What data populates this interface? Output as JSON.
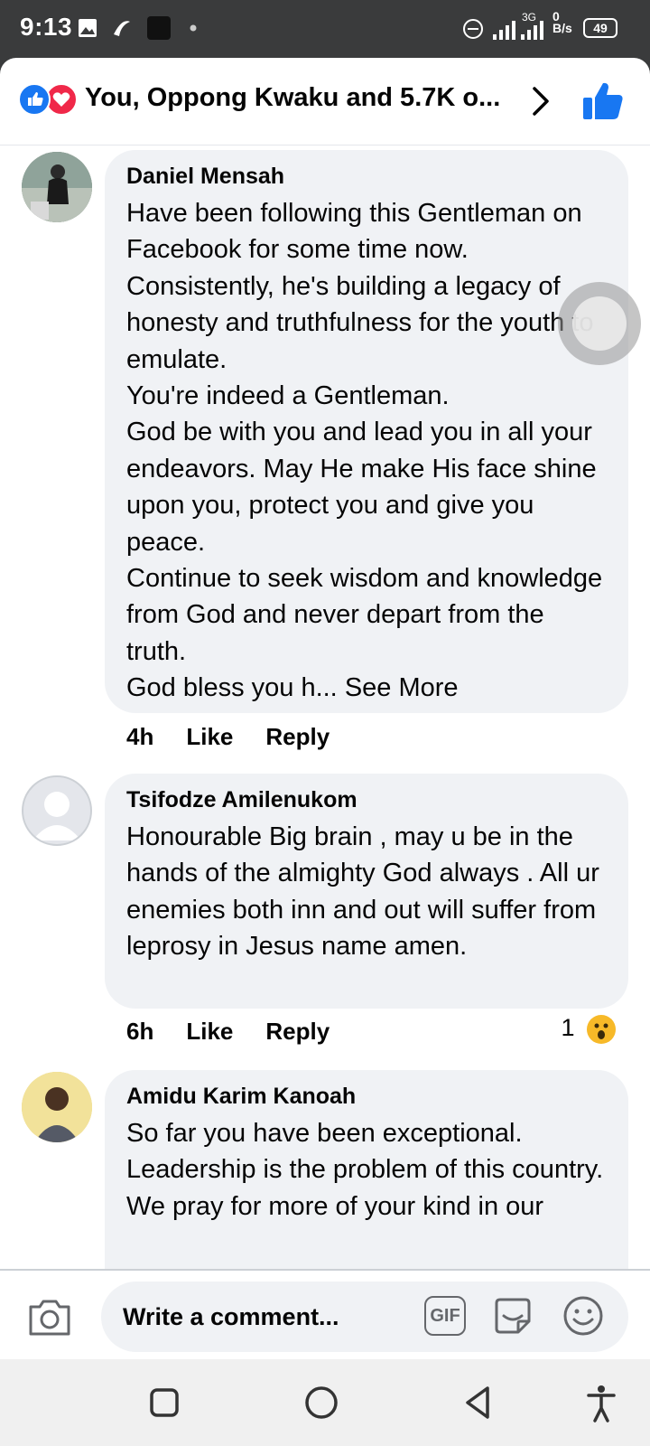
{
  "status": {
    "time": "9:13",
    "signal_label": "3G",
    "speed": "0\nB/s",
    "battery": "49"
  },
  "header": {
    "title": "You, Oppong Kwaku and 5.7K o..."
  },
  "comments": [
    {
      "author": "Daniel Mensah",
      "text": "Have been following this Gentleman on Facebook for some time now.\nConsistently, he's building a legacy of honesty and truthfulness for the youth to emulate.\nYou're indeed a Gentleman.\nGod be with you and lead you in all your endeavors. May He make His face shine upon you, protect you and give you peace.\nContinue to seek wisdom and knowledge from God and never depart from the truth.\nGod bless you h... ",
      "see_more": "See More",
      "time": "4h",
      "like": "Like",
      "reply": "Reply"
    },
    {
      "author": "Tsifodze Amilenukom",
      "text": " Honourable Big brain , may  u be in the hands of the almighty God always . All ur enemies both inn and out will suffer from leprosy in Jesus name amen.",
      "time": "6h",
      "like": "Like",
      "reply": "Reply",
      "reaction_count": "1"
    },
    {
      "author": "Amidu Karim Kanoah",
      "text": "So far you have been exceptional.\nLeadership is the problem of this country.\nWe pray for more of your kind in our",
      "time": "",
      "like": "",
      "reply": ""
    }
  ],
  "composer": {
    "placeholder": "Write a comment...",
    "gif_label": "GIF"
  },
  "icons": {
    "like_reaction": "like-icon",
    "love_reaction": "love-icon",
    "chevron": "chevron-right-icon",
    "thumbs": "thumbs-up-icon",
    "camera": "camera-icon",
    "sticker": "sticker-icon",
    "emoji": "emoji-icon",
    "wow": "wow-reaction-icon"
  },
  "colors": {
    "brand": "#1877f2",
    "love": "#f02849",
    "bubble": "#f0f2f5",
    "wow": "#f7b928"
  }
}
